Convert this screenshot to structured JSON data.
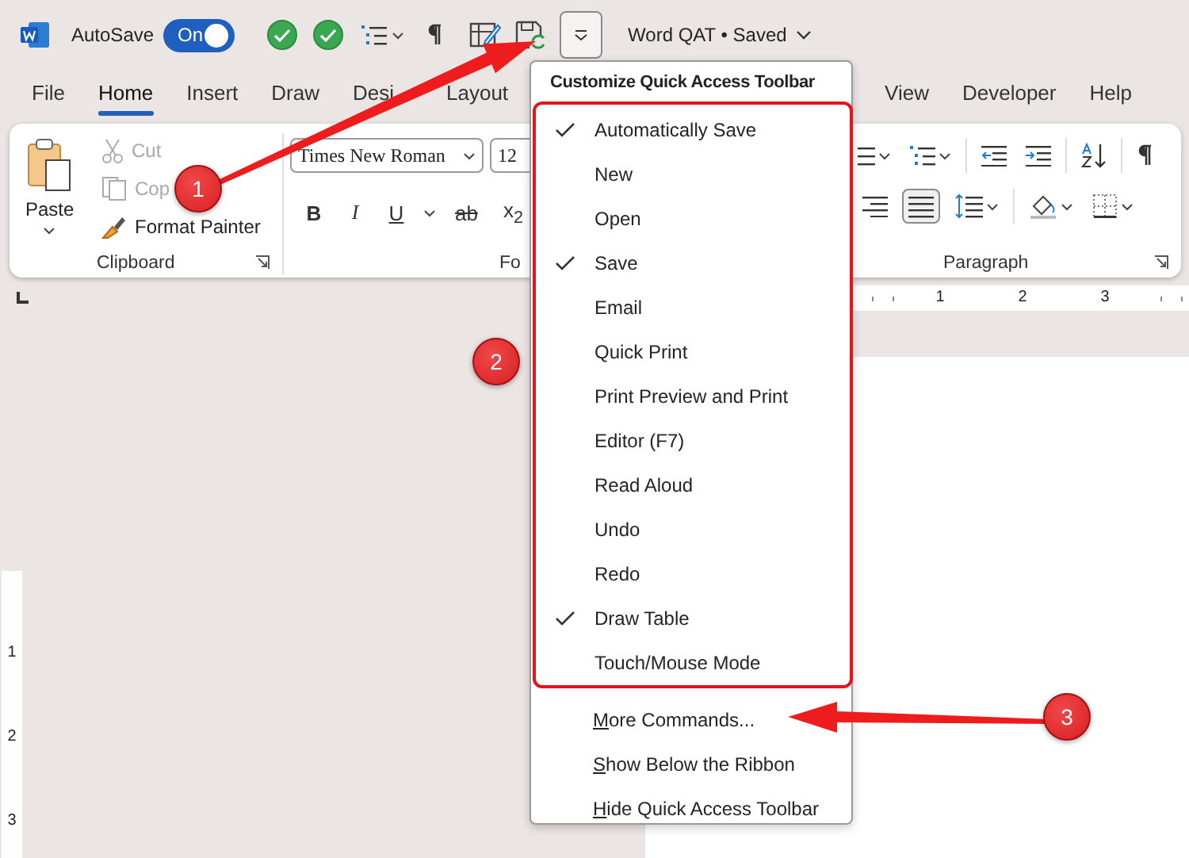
{
  "title_bar": {
    "autosave_label": "AutoSave",
    "autosave_toggle": {
      "label": "On",
      "on": true
    },
    "customize_button": {
      "open": true
    },
    "document_title": "Word QAT • Saved"
  },
  "tabs": [
    {
      "label": "File",
      "selected": false
    },
    {
      "label": "Home",
      "selected": true
    },
    {
      "label": "Insert",
      "selected": false
    },
    {
      "label": "Draw",
      "selected": false
    },
    {
      "label": "Desi",
      "selected": false
    },
    {
      "label": "Layout",
      "selected": false
    },
    {
      "label": "View",
      "selected": false
    },
    {
      "label": "Developer",
      "selected": false
    },
    {
      "label": "Help",
      "selected": false
    }
  ],
  "clipboard": {
    "paste": "Paste",
    "cut": {
      "label": "Cut",
      "disabled": true
    },
    "copy": {
      "label": "Cop",
      "disabled": true
    },
    "format_painter": "Format Painter",
    "group_label": "Clipboard"
  },
  "font": {
    "font_name": "Times New Roman",
    "font_size": "12",
    "format_buttons": [
      "B",
      "I",
      "U",
      "ab",
      "x$_{2}$"
    ],
    "group_label": "Fo"
  },
  "paragraph": {
    "group_label": "Paragraph",
    "justify_selected": true
  },
  "ruler": {
    "horizontal_numbers": [
      "1",
      "2",
      "3"
    ],
    "vertical_numbers": [
      "1",
      "2",
      "3"
    ]
  },
  "menu": {
    "title": "Customize Quick Access Toolbar",
    "items": [
      {
        "label": "Automatically Save",
        "checked": true
      },
      {
        "label": "New",
        "checked": false
      },
      {
        "label": "Open",
        "checked": false
      },
      {
        "label": "Save",
        "checked": true
      },
      {
        "label": "Email",
        "checked": false
      },
      {
        "label": "Quick Print",
        "checked": false
      },
      {
        "label": "Print Preview and Print",
        "checked": false
      },
      {
        "label": "Editor (F7)",
        "checked": false
      },
      {
        "label": "Read Aloud",
        "checked": false
      },
      {
        "label": "Undo",
        "checked": false
      },
      {
        "label": "Redo",
        "checked": false
      },
      {
        "label": "Draw Table",
        "checked": true
      },
      {
        "label": "Touch/Mouse Mode",
        "checked": false
      }
    ],
    "commands": [
      "More Commands...",
      "Show Below the Ribbon",
      "Hide Quick Access Toolbar"
    ]
  },
  "callouts": [
    "1",
    "2",
    "3"
  ]
}
